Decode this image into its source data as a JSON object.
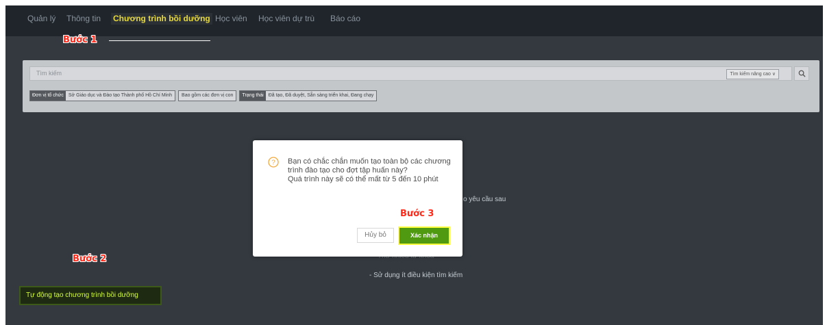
{
  "nav": {
    "items": [
      {
        "label": "Quản lý"
      },
      {
        "label": "Thông tin"
      },
      {
        "label": "Chương trình bồi dưỡng"
      },
      {
        "label": "Học viên"
      },
      {
        "label": "Học viên dự trù"
      },
      {
        "label": "Báo cáo"
      }
    ],
    "active_index": 2
  },
  "annotations": {
    "step1": "Bước 1",
    "step2": "Bước 2",
    "step3": "Bước 3",
    "step_color": "#ff2a1a"
  },
  "search": {
    "placeholder": "Tìm kiếm",
    "advanced_label": "Tìm kiếm nâng cao ∨",
    "icon": "search-icon"
  },
  "filters": [
    {
      "tag": "Đơn vị tổ chức",
      "value": "Sở Giáo dục và Đào tạo Thành phố Hồ Chí Minh"
    },
    {
      "tag": "",
      "value": "Bao gồm các đơn vị con"
    },
    {
      "tag": "Trạng thái",
      "value": "Đã tạo, Đã duyệt, Sẵn sàng triển khai, Đang chạy"
    }
  ],
  "empty_state": {
    "line_partial": "o yêu cầu sau",
    "line_faded": "Thử nhiều từ khoá",
    "line_last": "- Sử dụng ít điều kiện tìm kiếm"
  },
  "auto_create_button": "Tự động tạo chương trình bồi dưỡng",
  "dialog": {
    "icon": "question-circle-icon",
    "message": "Bạn có chắc chắn muốn tạo toàn bộ các chương trình đào tạo cho đợt tập huấn này?",
    "note": "Quá trình này sẽ có thể mất từ 5 đến 10 phút",
    "cancel_label": "Hủy bỏ",
    "confirm_label": "Xác nhận"
  },
  "colors": {
    "accent_yellow": "#e8d93a",
    "confirm_green": "#4f9a10",
    "highlight_yellow": "#ffff3d",
    "bg_dark": "#33393f"
  }
}
